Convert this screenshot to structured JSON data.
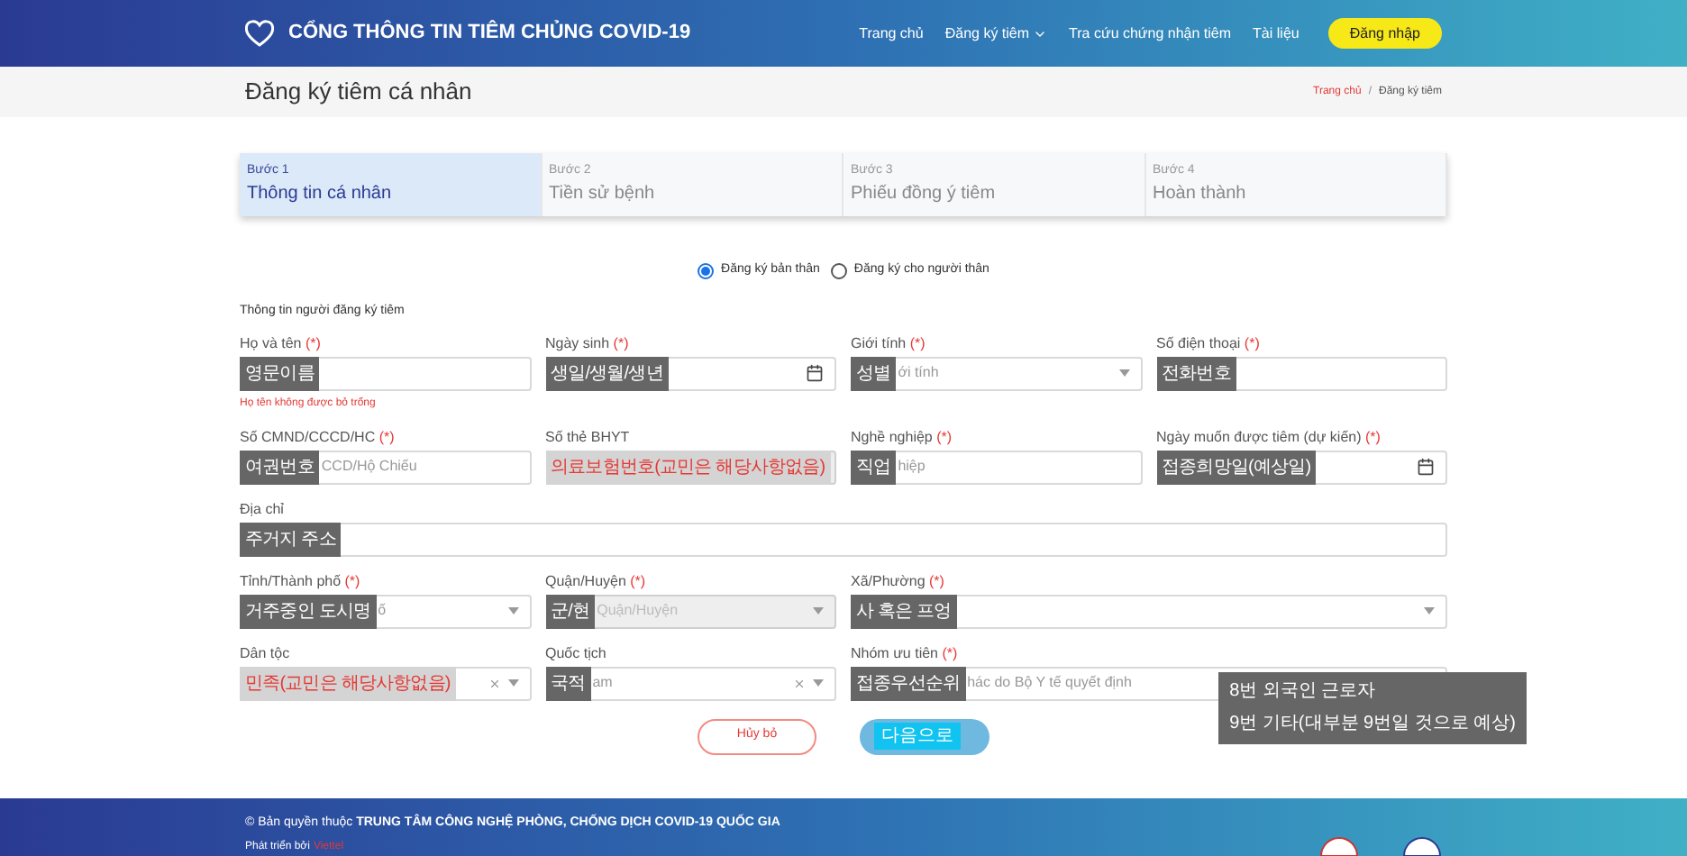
{
  "header": {
    "brand": "CỔNG THÔNG TIN TIÊM CHỦNG COVID-19",
    "nav": [
      {
        "label": "Trang chủ",
        "dropdown": false
      },
      {
        "label": "Đăng ký tiêm",
        "dropdown": true
      },
      {
        "label": "Tra cứu chứng nhận tiêm",
        "dropdown": false
      },
      {
        "label": "Tài liệu",
        "dropdown": false
      }
    ],
    "login": "Đăng nhập"
  },
  "page_title": "Đăng ký tiêm cá nhân",
  "breadcrumb": {
    "separator": "/",
    "items": [
      {
        "label": "Trang chủ",
        "link": true
      },
      {
        "label": "Đăng ký tiêm",
        "link": false
      }
    ]
  },
  "steps": [
    {
      "step": "Bước 1",
      "title": "Thông tin cá nhân",
      "selected": true
    },
    {
      "step": "Bước 2",
      "title": "Tiền sử bệnh",
      "selected": false
    },
    {
      "step": "Bước 3",
      "title": "Phiếu đồng ý tiêm",
      "selected": false
    },
    {
      "step": "Bước 4",
      "title": "Hoàn thành",
      "selected": false
    }
  ],
  "radios": [
    {
      "label": "Đăng ký bản thân",
      "selected": true
    },
    {
      "label": "Đăng ký cho người thân",
      "selected": false
    }
  ],
  "section_title": "Thông tin người đăng ký tiêm",
  "rows": [
    [
      {
        "label": "Họ và tên",
        "required": "(*)",
        "kind": "text",
        "note": {
          "text": "영문이름",
          "kind": "label"
        },
        "error": "Họ tên không được bỏ trống"
      },
      {
        "label": "Ngày sinh",
        "required": "(*)",
        "kind": "date",
        "note": {
          "text": "생일/생월/생년",
          "kind": "label"
        }
      },
      {
        "label": "Giới tính",
        "required": "(*)",
        "kind": "select",
        "text": "ới tính",
        "note": {
          "text": "성별",
          "kind": "label"
        }
      },
      {
        "label": "Số điện thoại",
        "required": "(*)",
        "kind": "text",
        "note": {
          "text": "전화번호",
          "kind": "label"
        }
      }
    ],
    [
      {
        "label": "Số CMND/CCCD/HC",
        "required": "(*)",
        "kind": "text",
        "text": "CCD/Hộ Chiếu",
        "note": {
          "text": "여권번호",
          "kind": "label"
        }
      },
      {
        "label": "Số thẻ BHYT",
        "kind": "text",
        "disabled": true,
        "note": {
          "text": "의료보험번호(교민은 해당사항없음)",
          "kind": "marker"
        }
      },
      {
        "label": "Nghề nghiệp",
        "required": "(*)",
        "kind": "text",
        "text": "hiệp",
        "note": {
          "text": "직업",
          "kind": "label"
        }
      },
      {
        "label": "Ngày muốn được tiêm (dự kiến)",
        "required": "(*)",
        "kind": "date",
        "note": {
          "text": "접종희망일(예상일)",
          "kind": "label"
        }
      }
    ],
    [
      {
        "label": "Địa chỉ",
        "kind": "text",
        "note": {
          "text": "주거지 주소",
          "kind": "label"
        }
      }
    ],
    [
      {
        "label": "Tỉnh/Thành phố",
        "required": "(*)",
        "kind": "select",
        "text": "ố",
        "note": {
          "text": "거주중인 도시명",
          "kind": "label"
        }
      },
      {
        "label": "Quận/Huyện",
        "required": "(*)",
        "kind": "select",
        "disabled": true,
        "text": "Quận/Huyện",
        "note": {
          "text": "군/현",
          "kind": "label"
        }
      },
      {
        "label": "Xã/Phường",
        "required": "(*)",
        "kind": "select",
        "note": {
          "text": "사 혹은 프엉",
          "kind": "label"
        }
      }
    ],
    [
      {
        "label": "Dân tộc",
        "kind": "select",
        "clearable": true,
        "note": {
          "text": "민족(교민은 해당사항없음)",
          "kind": "marker"
        }
      },
      {
        "label": "Quốc tịch",
        "kind": "select",
        "clearable": true,
        "text": "am",
        "note": {
          "text": "국적",
          "kind": "label"
        }
      },
      {
        "label": "Nhóm ưu tiên",
        "required": "(*)",
        "kind": "select",
        "text": "hác do Bộ Y tế quyết định",
        "note": {
          "text": "접종우선순위",
          "kind": "label"
        }
      }
    ]
  ],
  "side_note": [
    "8번 외국인 근로자",
    "9번 기타(대부분 9번일 것으로 예상)"
  ],
  "cancel": "Hủy bỏ",
  "next": "다음으로",
  "footer": {
    "copyright": "© Bản quyền thuộc **TRUNG TÂM CÔNG NGHỆ PHÒNG, CHỐNG DỊCH COVID-19 QUỐC GIA**",
    "dev_label": "Phát triển bởi",
    "dev_link": "Viettel"
  }
}
